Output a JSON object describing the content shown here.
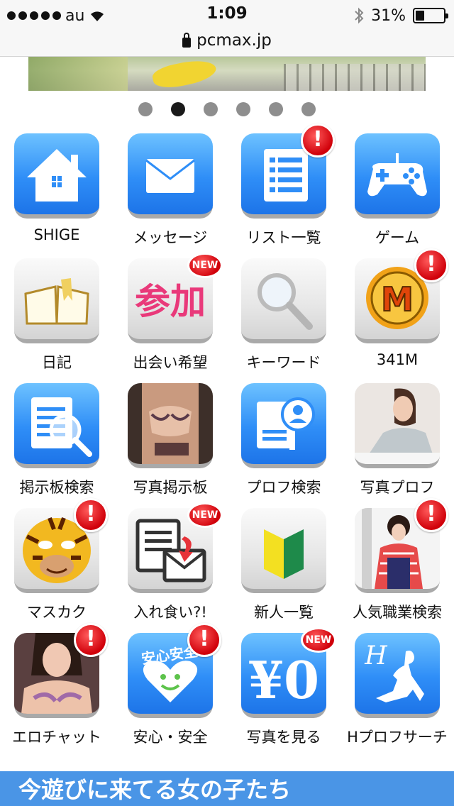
{
  "status": {
    "carrier": "au",
    "time": "1:09",
    "battery": "31%",
    "battery_level": 0.31
  },
  "browser": {
    "url": "pcmax.jp"
  },
  "pager": {
    "count": 6,
    "active": 1
  },
  "tiles": [
    {
      "label": "SHIGE",
      "icon": "home-icon",
      "style": "blue",
      "badge": ""
    },
    {
      "label": "メッセージ",
      "icon": "envelope-icon",
      "style": "blue",
      "badge": ""
    },
    {
      "label": "リスト一覧",
      "icon": "list-icon",
      "style": "blue",
      "badge": "!"
    },
    {
      "label": "ゲーム",
      "icon": "gamepad-icon",
      "style": "blue",
      "badge": ""
    },
    {
      "label": "日記",
      "icon": "book-icon",
      "style": "gray",
      "badge": ""
    },
    {
      "label": "出会い希望",
      "icon": "participate-text-icon",
      "style": "gray",
      "badge": "NEW",
      "icon_text": "参加"
    },
    {
      "label": "キーワード",
      "icon": "magnifier-icon",
      "style": "gray",
      "badge": ""
    },
    {
      "label": "341M",
      "icon": "m-coin-icon",
      "style": "gray",
      "badge": "!",
      "icon_text": "M"
    },
    {
      "label": "掲示板検索",
      "icon": "document-search-icon",
      "style": "blue",
      "badge": ""
    },
    {
      "label": "写真掲示板",
      "icon": "photo-board-thumbnail",
      "style": "photo",
      "badge": ""
    },
    {
      "label": "プロフ検索",
      "icon": "profile-search-icon",
      "style": "blue",
      "badge": ""
    },
    {
      "label": "写真プロフ",
      "icon": "photo-profile-thumbnail",
      "style": "photo",
      "badge": ""
    },
    {
      "label": "マスカク",
      "icon": "tiger-mask-icon",
      "style": "gray",
      "badge": "!"
    },
    {
      "label": "入れ食い?!",
      "icon": "mail-document-icon",
      "style": "gray",
      "badge": "NEW"
    },
    {
      "label": "新人一覧",
      "icon": "beginner-mark-icon",
      "style": "gray",
      "badge": ""
    },
    {
      "label": "人気職業検索",
      "icon": "kimono-photo-thumbnail",
      "style": "photo",
      "badge": "!"
    },
    {
      "label": "エロチャット",
      "icon": "chat-photo-thumbnail",
      "style": "photo",
      "badge": "!"
    },
    {
      "label": "安心・安全",
      "icon": "safety-heart-icon",
      "style": "blue",
      "badge": "!",
      "icon_text": "安心安全"
    },
    {
      "label": "写真を見る",
      "icon": "yen-zero-icon",
      "style": "blue",
      "badge": "NEW",
      "icon_text": "¥0"
    },
    {
      "label": "Hプロフサーチ",
      "icon": "h-silhouette-icon",
      "style": "blue",
      "badge": "",
      "icon_text": "H"
    }
  ],
  "promo": {
    "title": "今遊びに来てる女の子たち"
  },
  "colors": {
    "blue_icon": "#2f8ef7",
    "badge_red": "#d0000a",
    "promo_bar": "#4a95e6"
  }
}
